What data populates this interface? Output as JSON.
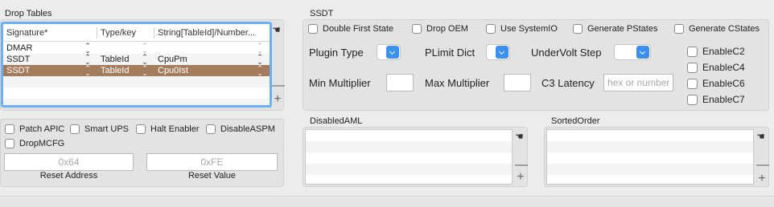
{
  "drop_tables": {
    "label": "Drop Tables",
    "columns": [
      "Signature*",
      "Type/key",
      "String[TableId]/Number..."
    ],
    "rows": [
      {
        "signature": "DMAR",
        "type": "",
        "value": ""
      },
      {
        "signature": "SSDT",
        "type": "TableId",
        "value": "CpuPm"
      },
      {
        "signature": "SSDT",
        "type": "TableId",
        "value": "Cpu0Ist"
      }
    ]
  },
  "left_options": {
    "checkboxes": [
      "Patch APIC",
      "Smart UPS",
      "Halt Enabler",
      "DisableASPM",
      "DropMCFG"
    ],
    "reset_address_placeholder": "0x64",
    "reset_address_label": "Reset Address",
    "reset_value_placeholder": "0xFE",
    "reset_value_label": "Reset Value"
  },
  "ssdt": {
    "label": "SSDT",
    "top_checkboxes": [
      "Double First State",
      "Drop OEM",
      "Use SystemIO",
      "Generate PStates",
      "Generate CStates"
    ],
    "plugin_type_label": "Plugin Type",
    "plimit_dict_label": "PLimit Dict",
    "undervolt_step_label": "UnderVolt Step",
    "min_multiplier_label": "Min Multiplier",
    "max_multiplier_label": "Max Multiplier",
    "c3_latency_label": "C3 Latency",
    "c3_latency_placeholder": "hex or number",
    "cstates": [
      "EnableC2",
      "EnableC4",
      "EnableC6",
      "EnableC7"
    ]
  },
  "disabled_aml": {
    "label": "DisabledAML"
  },
  "sorted_order": {
    "label": "SortedOrder"
  },
  "controls": {
    "add": "+",
    "remove": "—",
    "hand": "☚"
  },
  "colors": {
    "selected_row": "#a57c5b",
    "accent": "#3a8ff0"
  }
}
